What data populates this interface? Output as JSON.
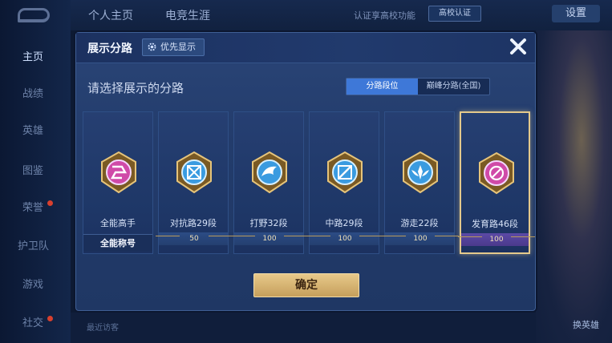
{
  "background": {
    "nav_items": [
      {
        "label": "主页",
        "active": true
      },
      {
        "label": "战绩",
        "active": false
      },
      {
        "label": "英雄",
        "active": false
      },
      {
        "label": "图鉴",
        "active": false
      },
      {
        "label": "荣誉",
        "active": false
      },
      {
        "label": "护卫队",
        "active": false
      },
      {
        "label": "游戏",
        "active": false
      },
      {
        "label": "社交",
        "active": false
      }
    ],
    "tabs": [
      "个人主页",
      "电竞生涯"
    ],
    "cert_text": "认证享高校功能",
    "cert_button": "高校认证",
    "settings": "设置",
    "recent_visitors": "最近访客",
    "swap_hero": "换英雄"
  },
  "modal": {
    "title": "展示分路",
    "priority_button": "优先显示",
    "subtitle": "请选择展示的分路",
    "segments": [
      {
        "label": "分路段位",
        "active": true
      },
      {
        "label": "巅峰分路(全国)",
        "active": false
      }
    ],
    "cards": [
      {
        "label": "全能高手",
        "badge": "",
        "title_bar": "全能称号",
        "emblem": "all-rounder-emblem-icon",
        "color": "#d04aa8",
        "selected": false
      },
      {
        "label": "对抗路29段",
        "badge": "50",
        "title_bar": "",
        "emblem": "clash-lane-emblem-icon",
        "color": "#3a9be0",
        "selected": false
      },
      {
        "label": "打野32段",
        "badge": "100",
        "title_bar": "",
        "emblem": "jungle-emblem-icon",
        "color": "#3a9be0",
        "selected": false
      },
      {
        "label": "中路29段",
        "badge": "100",
        "title_bar": "",
        "emblem": "mid-lane-emblem-icon",
        "color": "#3a9be0",
        "selected": false
      },
      {
        "label": "游走22段",
        "badge": "100",
        "title_bar": "",
        "emblem": "roam-emblem-icon",
        "color": "#3a9be0",
        "selected": false
      },
      {
        "label": "发育路46段",
        "badge": "100",
        "title_bar": "",
        "emblem": "farm-lane-emblem-icon",
        "color": "#d04aa8",
        "selected": true
      }
    ],
    "confirm_button": "确定"
  },
  "colors": {
    "accent_blue": "#3e78d8",
    "gold": "#e4c98c",
    "panel": "#233c6c"
  }
}
